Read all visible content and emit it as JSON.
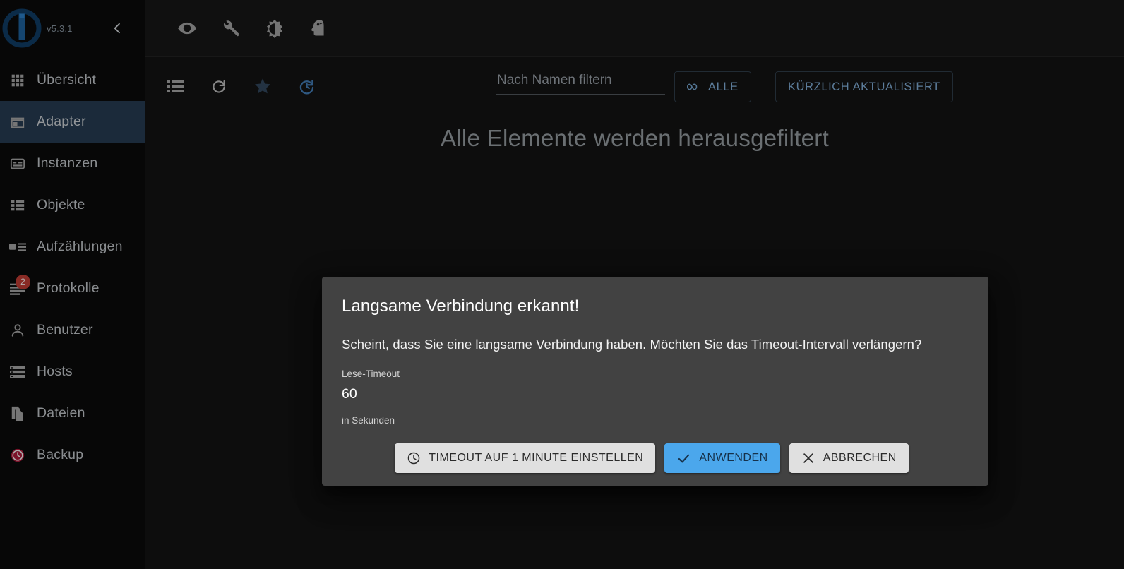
{
  "app": {
    "version_label": "v5.3.1",
    "accent_blue": "#4ba7ec",
    "selected_nav_bg": "#24394e",
    "badge_color": "#b73a32",
    "dialog_bg": "#424242"
  },
  "sidebar": {
    "collapse_icon": "chevron-left-icon",
    "items": [
      {
        "id": "overview",
        "label": "Übersicht",
        "icon": "grid-apps-icon",
        "selected": false,
        "badge": null
      },
      {
        "id": "adapters",
        "label": "Adapter",
        "icon": "store-icon",
        "selected": true,
        "badge": null
      },
      {
        "id": "instances",
        "label": "Instanzen",
        "icon": "subtitles-icon",
        "selected": false,
        "badge": null
      },
      {
        "id": "objects",
        "label": "Objekte",
        "icon": "list-alt-icon",
        "selected": false,
        "badge": null
      },
      {
        "id": "enums",
        "label": "Aufzählungen",
        "icon": "art-track-icon",
        "selected": false,
        "badge": null
      },
      {
        "id": "logs",
        "label": "Protokolle",
        "icon": "log-lines-icon",
        "selected": false,
        "badge": "2"
      },
      {
        "id": "users",
        "label": "Benutzer",
        "icon": "person-icon",
        "selected": false,
        "badge": null
      },
      {
        "id": "hosts",
        "label": "Hosts",
        "icon": "storage-icon",
        "selected": false,
        "badge": null
      },
      {
        "id": "files",
        "label": "Dateien",
        "icon": "file-copy-icon",
        "selected": false,
        "badge": null
      },
      {
        "id": "backup",
        "label": "Backup",
        "icon": "history-clock-icon",
        "selected": false,
        "badge": null
      }
    ]
  },
  "topbar": {
    "icons": [
      {
        "id": "visibility",
        "name": "eye-icon"
      },
      {
        "id": "build",
        "name": "wrench-icon"
      },
      {
        "id": "theme",
        "name": "brightness-contrast-icon"
      },
      {
        "id": "expert",
        "name": "head-psychology-icon"
      }
    ]
  },
  "toolbar": {
    "icons": [
      {
        "id": "list-view",
        "name": "list-view-icon",
        "color": "#9e9e9e"
      },
      {
        "id": "refresh",
        "name": "refresh-icon",
        "color": "#b0b0b0"
      },
      {
        "id": "favorites",
        "name": "star-icon",
        "color": "#2d3f52"
      },
      {
        "id": "updates",
        "name": "update-clock-icon",
        "color": "#3f6d9e"
      }
    ],
    "filter_placeholder": "Nach Namen filtern",
    "filter_value": "",
    "btn_all": {
      "label": "ALLE",
      "icon": "infinity-icon"
    },
    "btn_recently_updated": {
      "label": "KÜRZLICH AKTUALISIERT"
    }
  },
  "content": {
    "empty_message": "Alle Elemente werden herausgefiltert"
  },
  "dialog": {
    "title": "Langsame Verbindung erkannt!",
    "message": "Scheint, dass Sie eine langsame Verbindung haben. Möchten Sie das Timeout-Intervall verlängern?",
    "field_label": "Lese-Timeout",
    "field_value": "60",
    "field_help": "in Sekunden",
    "buttons": {
      "set_minute": {
        "label": "TIMEOUT AUF 1 MINUTE EINSTELLEN",
        "icon": "clock-icon"
      },
      "apply": {
        "label": "ANWENDEN",
        "icon": "check-icon"
      },
      "cancel": {
        "label": "ABBRECHEN",
        "icon": "close-icon"
      }
    }
  }
}
